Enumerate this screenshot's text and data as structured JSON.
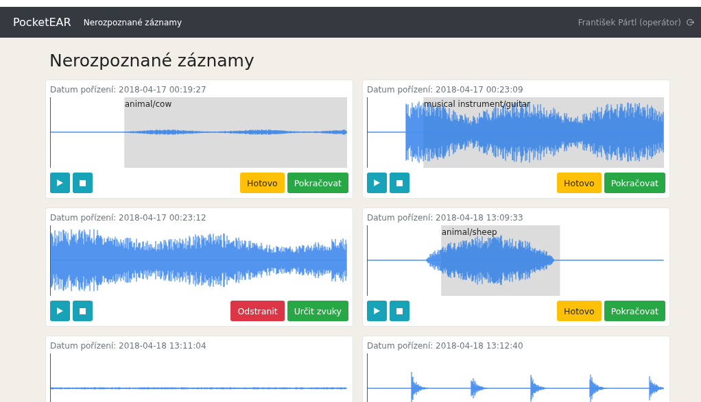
{
  "navbar": {
    "brand": "PocketEAR",
    "link": "Nerozpoznané záznamy",
    "user": "František Pártl (operátor)"
  },
  "page": {
    "title": "Nerozpoznané záznamy"
  },
  "recordings": [
    {
      "date": "Datum pořízení: 2018-04-17 00:19:27",
      "region": {
        "label": "animal/cow"
      },
      "buttons": [
        {
          "label": "Hotovo",
          "kind": "warning"
        },
        {
          "label": "Pokračovat",
          "kind": "success"
        }
      ]
    },
    {
      "date": "Datum pořízení: 2018-04-17 00:23:09",
      "region": {
        "label": "musical instrument/guitar"
      },
      "buttons": [
        {
          "label": "Hotovo",
          "kind": "warning"
        },
        {
          "label": "Pokračovat",
          "kind": "success"
        }
      ]
    },
    {
      "date": "Datum pořízení: 2018-04-17 00:23:12",
      "buttons": [
        {
          "label": "Odstranit",
          "kind": "danger"
        },
        {
          "label": "Určit zvuky",
          "kind": "success"
        }
      ]
    },
    {
      "date": "Datum pořízení: 2018-04-18 13:09:33",
      "region": {
        "label": "animal/sheep"
      },
      "buttons": [
        {
          "label": "Hotovo",
          "kind": "warning"
        },
        {
          "label": "Pokračovat",
          "kind": "success"
        }
      ]
    },
    {
      "date": "Datum pořízení: 2018-04-18 13:11:04"
    },
    {
      "date": "Datum pořízení: 2018-04-18 13:12:40"
    }
  ]
}
